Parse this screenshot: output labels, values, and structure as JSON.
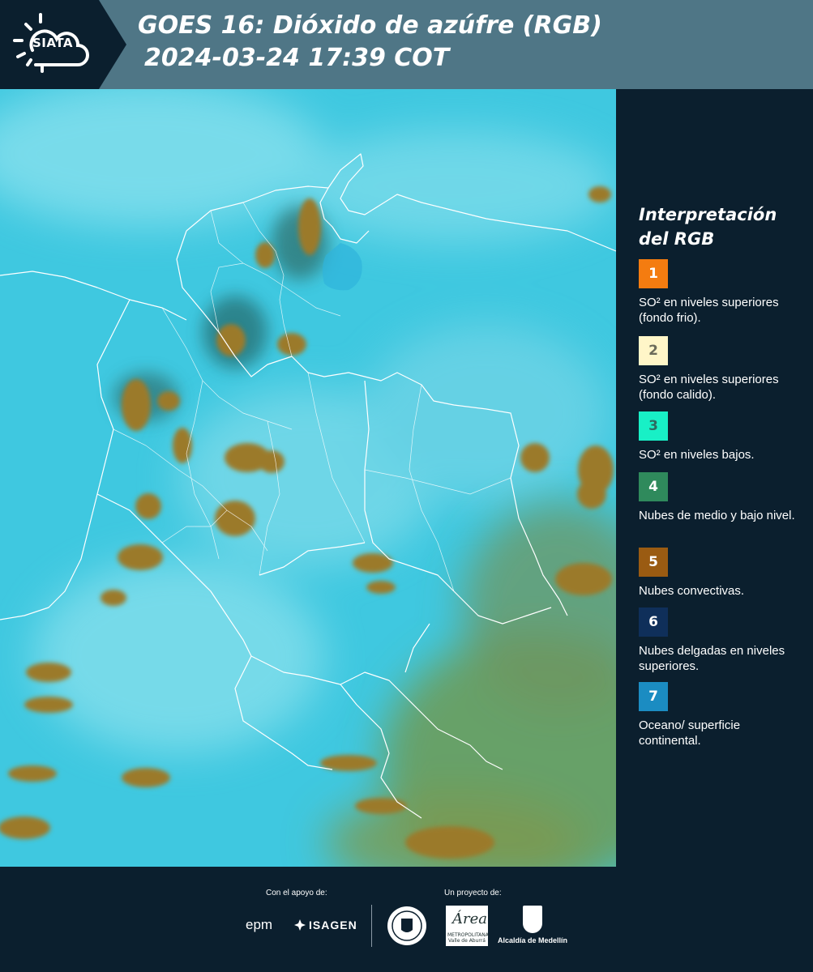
{
  "header": {
    "logo_text": "SIATA",
    "title_line1": "GOES 16: Dióxido de azúfre (RGB)",
    "title_line2": "2024-03-24 17:39 COT"
  },
  "legend": {
    "title_line1": "Interpretación",
    "title_line2": "del RGB",
    "items": [
      {
        "number": "1",
        "color": "#f47c10",
        "number_color": "#ffffff",
        "label": "SO² en niveles superiores (fondo frio)."
      },
      {
        "number": "2",
        "color": "#fff6c8",
        "number_color": "#6b6b5a",
        "label": "SO² en niveles superiores (fondo calido)."
      },
      {
        "number": "3",
        "color": "#18f0c6",
        "number_color": "#2d6b60",
        "label": "SO² en niveles bajos."
      },
      {
        "number": "4",
        "color": "#2f8a5c",
        "number_color": "#ffffff",
        "label": "Nubes de medio y bajo nivel."
      },
      {
        "number": "5",
        "color": "#9a5b12",
        "number_color": "#ffffff",
        "label": "Nubes convectivas."
      },
      {
        "number": "6",
        "color": "#0f2f5a",
        "number_color": "#ffffff",
        "label": "Nubes delgadas en niveles superiores."
      },
      {
        "number": "7",
        "color": "#1b8cc2",
        "number_color": "#ffffff",
        "label": "Oceano/ superficie continental."
      }
    ]
  },
  "footer": {
    "support_caption": "Con el apoyo de:",
    "project_caption": "Un proyecto de:",
    "sponsor_epm": "epm",
    "sponsor_isagen": "ISAGEN",
    "area_logo_big": "Área",
    "area_logo_small": "METROPOLITANA Valle de Aburrá",
    "alcaldia": "Alcaldía de Medellín"
  },
  "colors": {
    "header_bg": "#4f7686",
    "logo_bg": "#0b1f2e",
    "panel_bg": "#0b1f2e",
    "map_base": "#3fc8e0",
    "cloud_brown": "#9b7a2a"
  }
}
